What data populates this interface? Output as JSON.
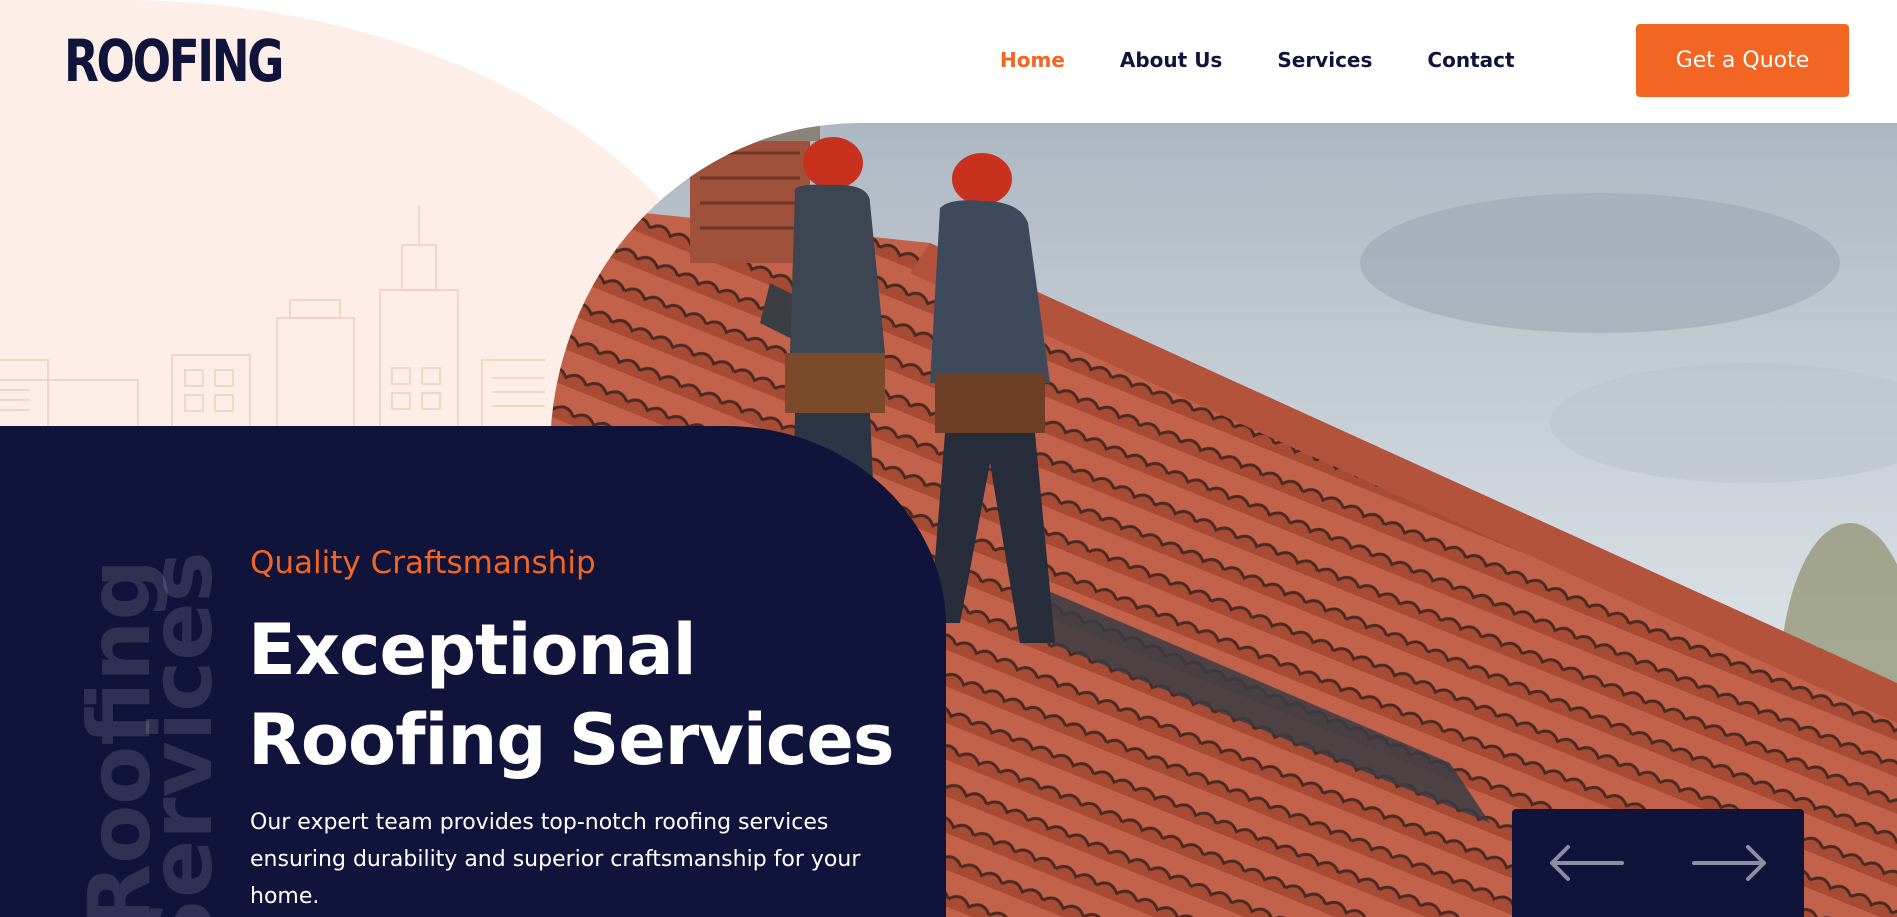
{
  "header": {
    "logo_text": "ROOFING",
    "nav": [
      {
        "label": "Home",
        "active": true
      },
      {
        "label": "About Us",
        "active": false
      },
      {
        "label": "Services",
        "active": false
      },
      {
        "label": "Contact",
        "active": false
      }
    ],
    "cta_label": "Get a Quote"
  },
  "hero": {
    "eyebrow": "Quality Craftsmanship",
    "headline_line1": "Exceptional",
    "headline_line2": "Roofing Services",
    "description": "Our expert team provides top-notch roofing services ensuring durability and superior craftsmanship for your home.",
    "vertical_text_1": "Roofing",
    "vertical_text_2": "Services"
  },
  "slider": {
    "prev_icon": "arrow-left-icon",
    "next_icon": "arrow-right-icon"
  },
  "colors": {
    "accent": "#f26522",
    "navy": "#10133a",
    "peach": "#fdeee8"
  }
}
